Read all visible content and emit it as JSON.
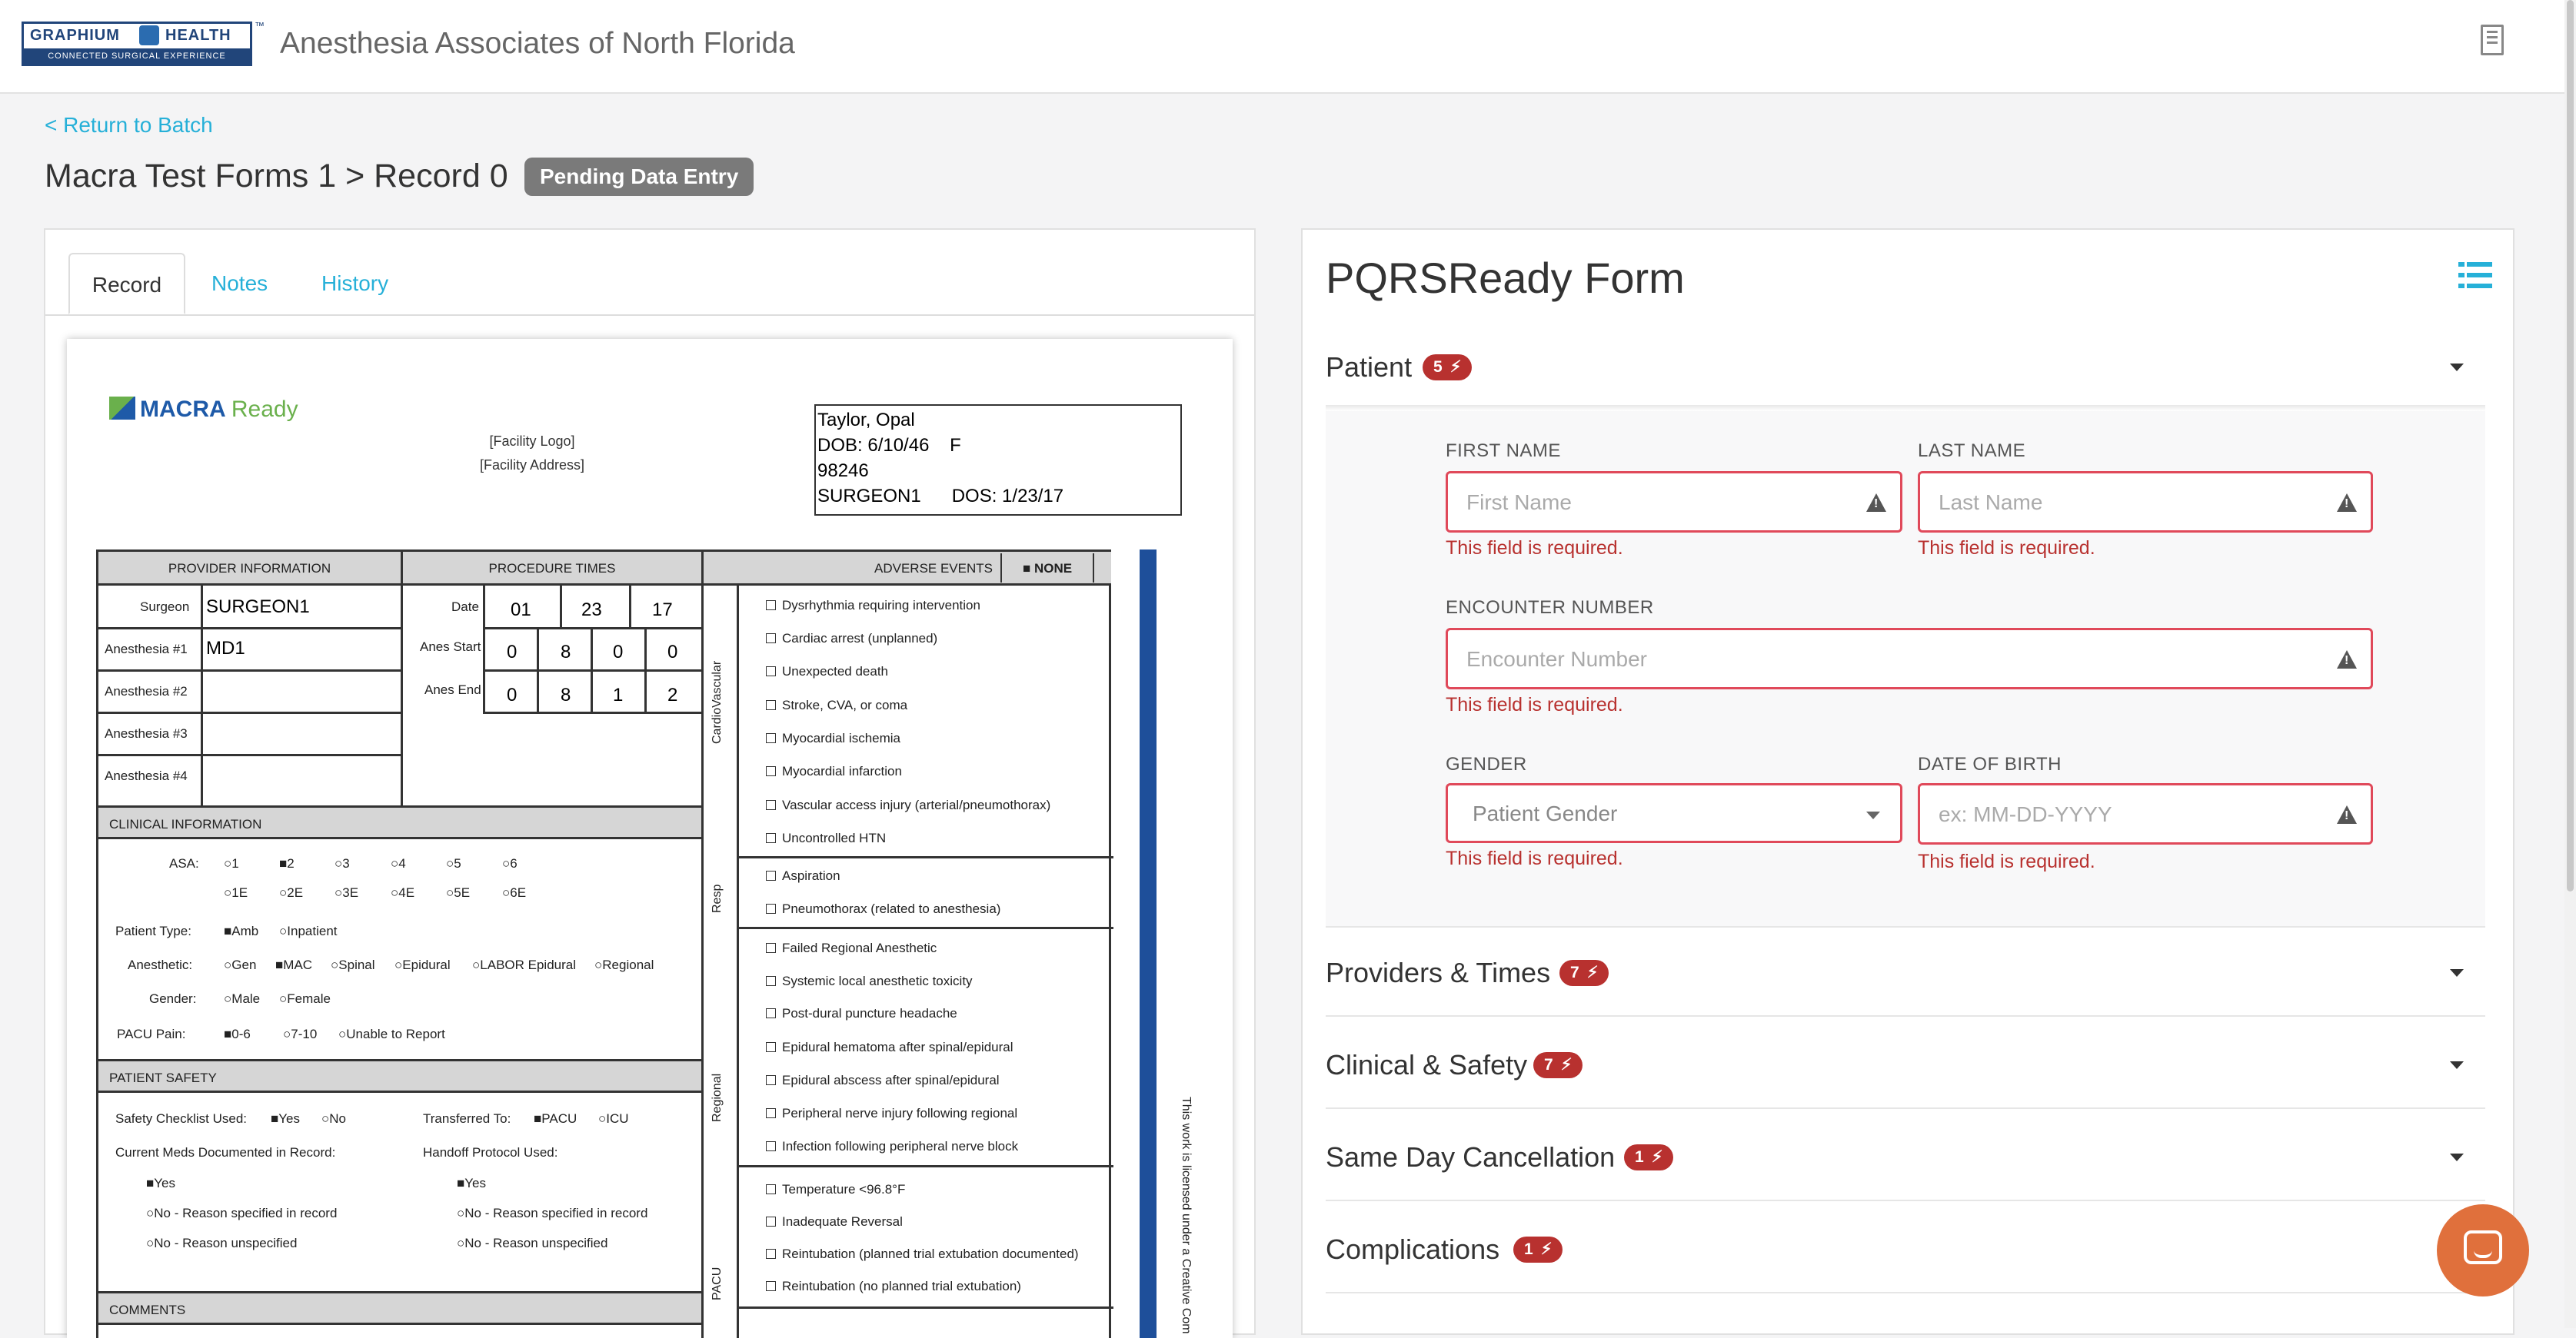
{
  "header": {
    "logo_text_left": "GRAPHIUM",
    "logo_text_right": "HEALTH",
    "logo_tagline": "CONNECTED SURGICAL EXPERIENCE",
    "logo_tm": "™",
    "org_name": "Anesthesia Associates of North Florida"
  },
  "nav": {
    "back_link": "< Return to Batch"
  },
  "page": {
    "title": "Macra Test Forms 1 > Record 0",
    "status_badge": "Pending Data Entry"
  },
  "left_tabs": [
    {
      "label": "Record"
    },
    {
      "label": "Notes"
    },
    {
      "label": "History"
    }
  ],
  "scan": {
    "logo_main": "MACRA",
    "logo_ready": "Ready",
    "facility_logo": "[Facility Logo]",
    "facility_address": "[Facility Address]",
    "patient_box": [
      "Taylor, Opal",
      "DOB: 6/10/46    F",
      "98246",
      "SURGEON1      DOS: 1/23/17"
    ],
    "headers": {
      "provider": "PROVIDER INFORMATION",
      "times": "PROCEDURE TIMES",
      "adverse": "ADVERSE EVENTS",
      "none": "NONE",
      "clinical": "CLINICAL INFORMATION",
      "safety": "PATIENT SAFETY",
      "comments": "COMMENTS"
    },
    "provider_rows": [
      {
        "label": "Surgeon",
        "value": "SURGEON1"
      },
      {
        "label": "Anesthesia #1",
        "value": "MD1"
      },
      {
        "label": "Anesthesia #2",
        "value": ""
      },
      {
        "label": "Anesthesia #3",
        "value": ""
      },
      {
        "label": "Anesthesia #4",
        "value": ""
      }
    ],
    "times": {
      "date_label": "Date",
      "date": [
        "01",
        "23",
        "17"
      ],
      "start_label": "Anes Start",
      "start": [
        "0",
        "8",
        "0",
        "0"
      ],
      "end_label": "Anes End",
      "end": [
        "0",
        "8",
        "1",
        "2"
      ]
    },
    "adverse_groups": [
      {
        "name": "CardioVascular",
        "items": [
          "Dysrhythmia requiring intervention",
          "Cardiac arrest (unplanned)",
          "Unexpected death",
          "Stroke, CVA, or coma",
          "Myocardial  ischemia",
          "Myocardial infarction",
          "Vascular access injury (arterial/pneumothorax)",
          "Uncontrolled HTN"
        ]
      },
      {
        "name": "Resp",
        "items": [
          "Aspiration",
          "Pneumothorax (related to anesthesia)"
        ]
      },
      {
        "name": "Regional",
        "items": [
          "Failed Regional Anesthetic",
          "Systemic local anesthetic toxicity",
          "Post-dural puncture headache",
          "Epidural hematoma after spinal/epidural",
          "Epidural abscess after spinal/epidural",
          "Peripheral nerve injury following regional",
          "Infection following peripheral nerve block"
        ]
      },
      {
        "name": "PACU",
        "items": [
          "Temperature <96.8°F",
          "Inadequate Reversal",
          "Reintubation (planned trial extubation documented)",
          "Reintubation (no planned trial extubation)"
        ]
      }
    ],
    "clinical": {
      "asa_label": "ASA:",
      "asa_row1": [
        "1",
        "2",
        "3",
        "4",
        "5",
        "6"
      ],
      "asa_row2": [
        "1E",
        "2E",
        "3E",
        "4E",
        "5E",
        "6E"
      ],
      "ptype_label": "Patient Type:",
      "ptype": [
        "Amb",
        "Inpatient"
      ],
      "anes_label": "Anesthetic:",
      "anes": [
        "Gen",
        "MAC",
        "Spinal",
        "Epidural",
        "LABOR Epidural",
        "Regional"
      ],
      "gender_label": "Gender:",
      "gender": [
        "Male",
        "Female"
      ],
      "pacu_label": "PACU Pain:",
      "pacu": [
        "0-6",
        "7-10",
        "Unable to Report"
      ]
    },
    "safety": {
      "checklist_label": "Safety Checklist Used:",
      "checklist": [
        "Yes",
        "No"
      ],
      "transfer_label": "Transferred To:",
      "transfer": [
        "PACU",
        "ICU"
      ],
      "meds_label": "Current Meds Documented in Record:",
      "handoff_label": "Handoff Protocol Used:",
      "opts": [
        "Yes",
        "No - Reason specified in record",
        "No - Reason unspecified"
      ]
    },
    "license_text": "This work is licensed under a Creative Com"
  },
  "form": {
    "title": "PQRSReady Form",
    "sections": [
      {
        "title": "Patient",
        "count": "5"
      },
      {
        "title": "Providers & Times",
        "count": "7"
      },
      {
        "title": "Clinical & Safety",
        "count": "7"
      },
      {
        "title": "Same Day Cancellation",
        "count": "1"
      },
      {
        "title": "Complications",
        "count": "1"
      }
    ],
    "fields": {
      "first_name": {
        "label": "FIRST NAME",
        "placeholder": "First Name",
        "error": "This field is required."
      },
      "last_name": {
        "label": "LAST NAME",
        "placeholder": "Last Name",
        "error": "This field is required."
      },
      "encounter": {
        "label": "ENCOUNTER NUMBER",
        "placeholder": "Encounter Number",
        "error": "This field is required."
      },
      "gender": {
        "label": "GENDER",
        "placeholder": "Patient Gender",
        "error": "This field is required."
      },
      "dob": {
        "label": "DATE OF BIRTH",
        "placeholder": "ex: MM-DD-YYYY",
        "error": "This field is required."
      }
    }
  },
  "colors": {
    "accent": "#26b0d8",
    "error": "#b8312f",
    "brand": "#21457a",
    "chat": "#e0703c"
  }
}
